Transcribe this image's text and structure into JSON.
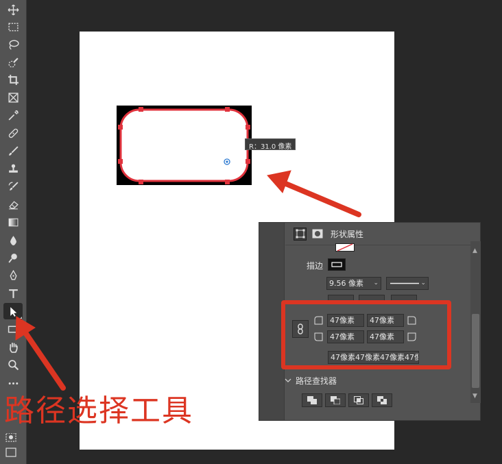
{
  "canvas": {
    "radius_tooltip": "R：31.0 像素"
  },
  "annotation": {
    "label": "路径选择工具"
  },
  "properties_panel": {
    "title": "形状属性",
    "stroke_label": "描边",
    "stroke_width": "9.56 像素",
    "corner_radii": {
      "top_left": "47像素",
      "top_right": "47像素",
      "bottom_left": "47像素",
      "bottom_right": "47像素",
      "combined": "47像素47像素47像素47像"
    },
    "path_finder_title": "路径查找器"
  },
  "toolbar": {
    "tools": [
      {
        "name": "move-tool",
        "icon": "move-icon"
      },
      {
        "name": "marquee-tool",
        "icon": "rect-marquee-icon"
      },
      {
        "name": "lasso-tool",
        "icon": "lasso-icon"
      },
      {
        "name": "quick-select-tool",
        "icon": "quick-select-icon"
      },
      {
        "name": "crop-tool",
        "icon": "crop-icon"
      },
      {
        "name": "frame-tool",
        "icon": "frame-icon"
      },
      {
        "name": "eyedropper-tool",
        "icon": "eyedropper-icon"
      },
      {
        "name": "healing-brush-tool",
        "icon": "bandage-icon"
      },
      {
        "name": "brush-tool",
        "icon": "brush-icon"
      },
      {
        "name": "stamp-tool",
        "icon": "stamp-icon"
      },
      {
        "name": "history-brush-tool",
        "icon": "history-brush-icon"
      },
      {
        "name": "eraser-tool",
        "icon": "eraser-icon"
      },
      {
        "name": "gradient-tool",
        "icon": "gradient-icon"
      },
      {
        "name": "blur-tool",
        "icon": "drop-icon"
      },
      {
        "name": "dodge-tool",
        "icon": "dodge-icon"
      },
      {
        "name": "pen-tool",
        "icon": "pen-icon"
      },
      {
        "name": "type-tool",
        "icon": "type-icon"
      },
      {
        "name": "path-selection-tool",
        "icon": "arrow-icon",
        "active": true
      },
      {
        "name": "rectangle-tool",
        "icon": "rectangle-icon"
      },
      {
        "name": "hand-tool",
        "icon": "hand-icon"
      },
      {
        "name": "zoom-tool",
        "icon": "zoom-icon"
      },
      {
        "name": "more-tools",
        "icon": "more-icon"
      }
    ]
  },
  "colors": {
    "accent_red": "#dc3522",
    "handle_red": "#e0333d",
    "panel_bg": "#535353",
    "app_bg": "#282828"
  }
}
